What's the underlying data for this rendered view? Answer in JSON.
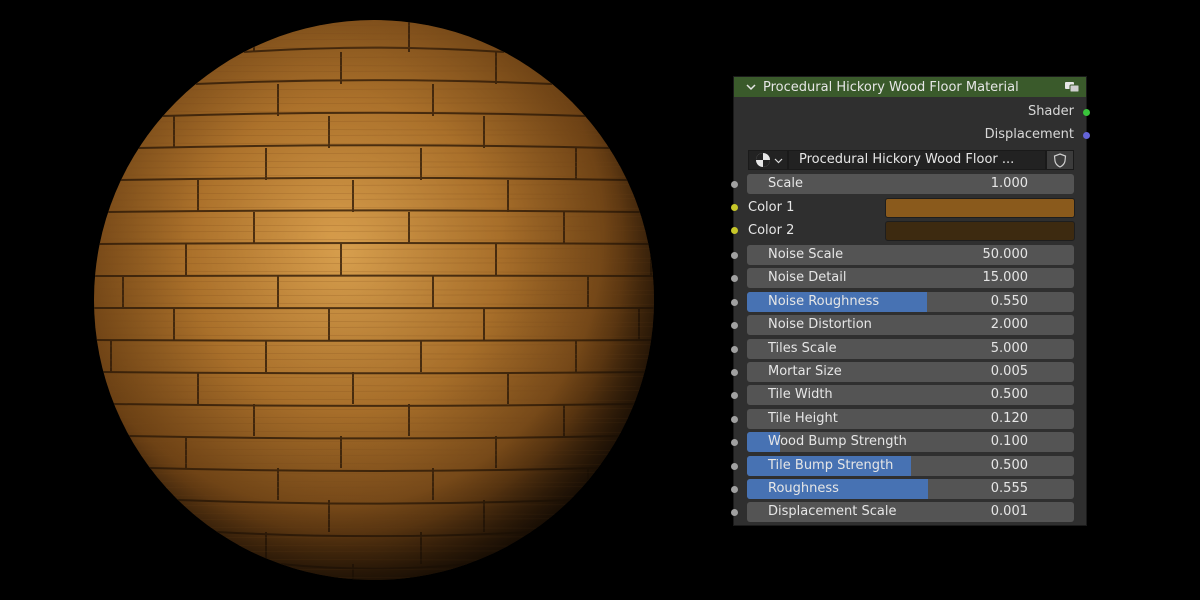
{
  "node": {
    "title": "Procedural Hickory Wood Floor Material",
    "outputs": [
      {
        "label": "Shader",
        "color": "#39c43b"
      },
      {
        "label": "Displacement",
        "color": "#6464d8"
      }
    ],
    "material_name": "Procedural Hickory Wood Floor ...",
    "icons": {
      "header": "node-group-icon",
      "material": "material-sphere-icon",
      "shield": "fake-user-shield-icon"
    },
    "scale": {
      "label": "Scale",
      "value": "1.000"
    },
    "color1": {
      "label": "Color 1",
      "color": "#8a5a1c"
    },
    "color2": {
      "label": "Color 2",
      "color": "#3d2a10"
    },
    "fields": [
      {
        "label": "Noise Scale",
        "value": "50.000",
        "fill": 0
      },
      {
        "label": "Noise Detail",
        "value": "15.000",
        "fill": 0
      },
      {
        "label": "Noise Roughness",
        "value": "0.550",
        "fill": 0.55
      },
      {
        "label": "Noise Distortion",
        "value": "2.000",
        "fill": 0
      },
      {
        "label": "Tiles Scale",
        "value": "5.000",
        "fill": 0
      },
      {
        "label": "Mortar Size",
        "value": "0.005",
        "fill": 0
      },
      {
        "label": "Tile Width",
        "value": "0.500",
        "fill": 0
      },
      {
        "label": "Tile Height",
        "value": "0.120",
        "fill": 0
      },
      {
        "label": "Wood Bump Strength",
        "value": "0.100",
        "fill": 0.1
      },
      {
        "label": "Tile Bump Strength",
        "value": "0.500",
        "fill": 0.5
      },
      {
        "label": "Roughness",
        "value": "0.555",
        "fill": 0.555
      },
      {
        "label": "Displacement Scale",
        "value": "0.001",
        "fill": 0
      }
    ]
  },
  "preview": {
    "name": "wood-floor-sphere-preview",
    "wood_light": "#c98a3a",
    "wood_dark": "#6b3f12"
  }
}
